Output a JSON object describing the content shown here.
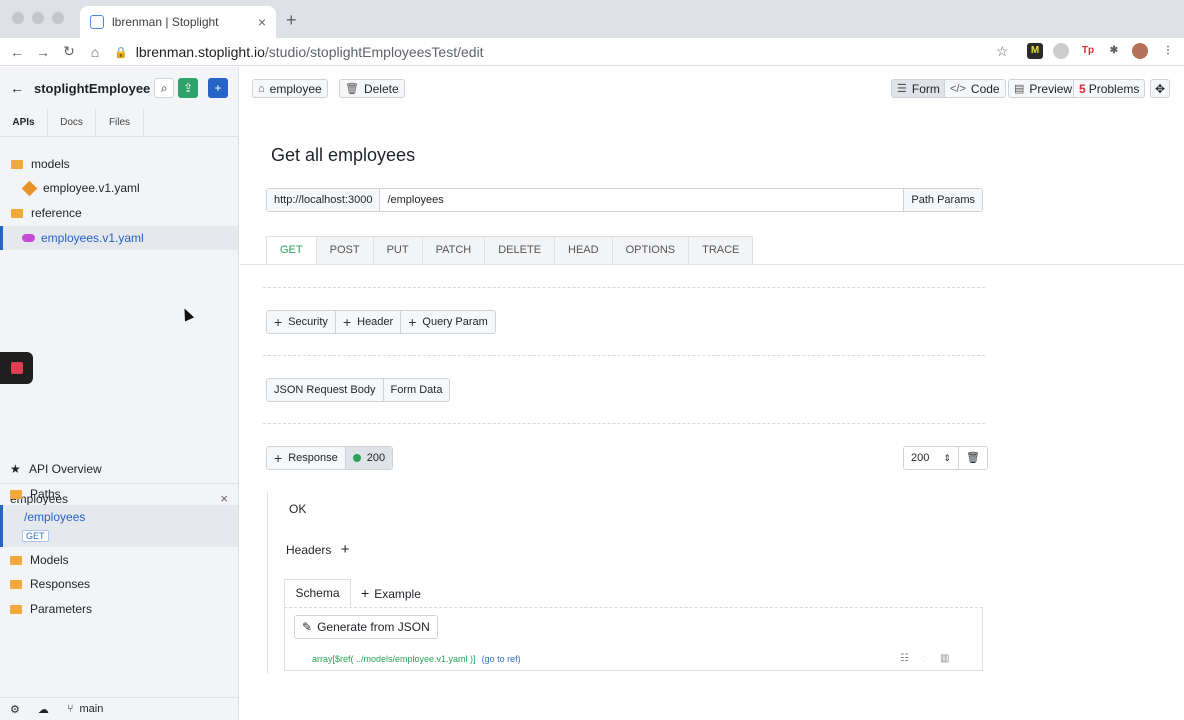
{
  "browser": {
    "tab_title": "lbrenman | Stoplight",
    "tab_close": "×",
    "new_tab": "+",
    "url_host": "lbrenman.stoplight.io",
    "url_path": "/studio/stoplightEmployeesTest/edit",
    "icons": {
      "back": "←",
      "forward": "→",
      "reload": "↻",
      "home": "⌂",
      "lock": "🔒",
      "star": "☆"
    }
  },
  "sidebar": {
    "back_icon": "←",
    "project_name": "stoplightEmployee",
    "tabs": [
      "APIs",
      "Docs",
      "Files"
    ],
    "tree": [
      {
        "label": "models",
        "icon": "folder"
      },
      {
        "label": "employee.v1.yaml",
        "icon": "model-icon"
      },
      {
        "label": "reference",
        "icon": "folder"
      },
      {
        "label": "employees.v1.yaml",
        "icon": "api-icon",
        "selected": true
      }
    ],
    "overview": {
      "title": "employees",
      "close": "×",
      "items": [
        {
          "label": "API Overview",
          "icon": "star-icon"
        },
        {
          "label": "Paths",
          "icon": "folder"
        },
        {
          "label": "/employees",
          "selected": true
        },
        {
          "label": "Models",
          "icon": "folder"
        },
        {
          "label": "Responses",
          "icon": "folder"
        },
        {
          "label": "Parameters",
          "icon": "folder"
        }
      ],
      "method_badge": "GET"
    },
    "footer": {
      "branch": "main"
    }
  },
  "main": {
    "topbar": {
      "tag_label": "employee",
      "delete_label": "Delete",
      "form_label": "Form",
      "code_label": "Code",
      "preview_label": "Preview",
      "problems_count": "5",
      "problems_label": "Problems"
    },
    "title": "Get all employees",
    "server": "http://localhost:3000",
    "path": "/employees",
    "path_params_label": "Path Params",
    "methods": [
      "GET",
      "POST",
      "PUT",
      "PATCH",
      "DELETE",
      "HEAD",
      "OPTIONS",
      "TRACE"
    ],
    "active_method": "GET",
    "params_buttons": [
      "Security",
      "Header",
      "Query Param"
    ],
    "body_buttons": [
      "JSON Request Body",
      "Form Data"
    ],
    "response_label": "Response",
    "response_code": "200",
    "status_select": "200",
    "response_description": "OK",
    "headers_label": "Headers",
    "schema_tab": "Schema",
    "example_tab": "Example",
    "generate_label": "Generate from JSON",
    "schema_ref": "array[$ref( ../models/employee.v1.yaml )]",
    "goto_ref": "(go to ref)"
  },
  "colors": {
    "accent_green": "#27a35a",
    "accent_blue": "#2563c7",
    "problems_red": "#d62d3b"
  }
}
